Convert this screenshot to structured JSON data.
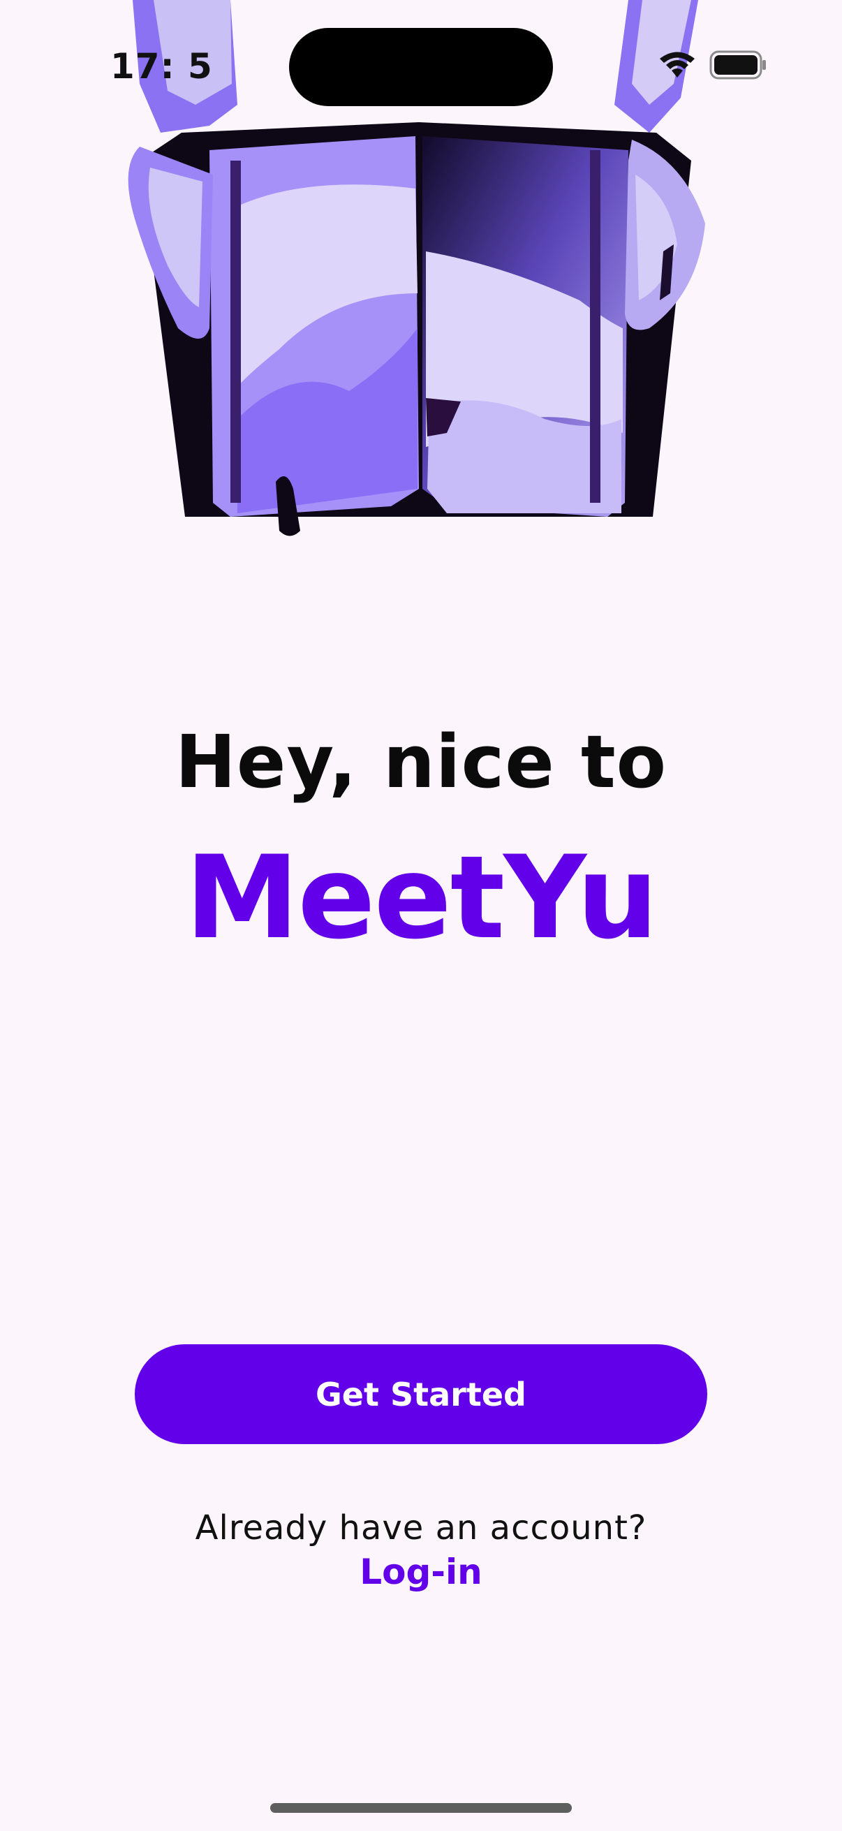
{
  "status_bar": {
    "time": "17:  5"
  },
  "welcome": {
    "heading": "Hey, nice to",
    "brand": "MeetYu"
  },
  "actions": {
    "get_started_label": "Get Started",
    "account_prompt": "Already have an account?",
    "login_label": "Log-in"
  },
  "colors": {
    "accent": "#6200ea",
    "background": "#fcf5fc",
    "illustration_light": "#dcd6f7",
    "illustration_mid": "#a890f7",
    "illustration_dark": "#7b5cf0"
  },
  "icons": [
    "wifi-icon",
    "battery-icon"
  ]
}
